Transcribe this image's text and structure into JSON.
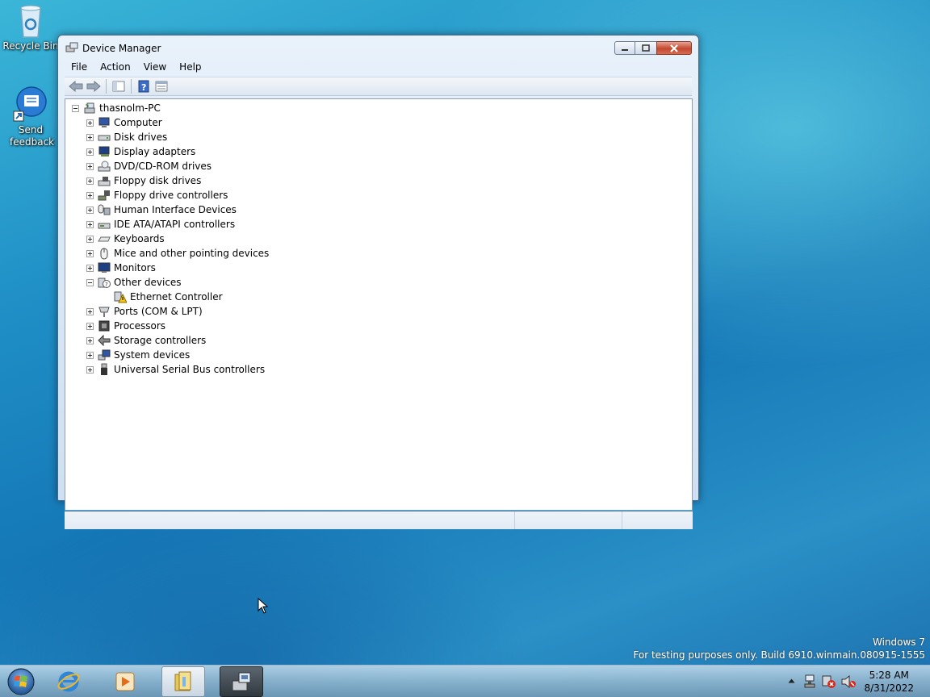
{
  "desktop": {
    "icons": [
      {
        "label": "Recycle Bin"
      },
      {
        "label": "Send feedback"
      }
    ],
    "watermark": {
      "line1": "Windows 7",
      "line2": "For testing purposes only. Build 6910.winmain.080915-1555"
    }
  },
  "window": {
    "title": "Device Manager",
    "menu": [
      "File",
      "Action",
      "View",
      "Help"
    ],
    "tree": {
      "root": "thasnolm-PC",
      "categories": [
        {
          "label": "Computer",
          "icon": "computer-icon"
        },
        {
          "label": "Disk drives",
          "icon": "disk-drive-icon"
        },
        {
          "label": "Display adapters",
          "icon": "display-adapter-icon"
        },
        {
          "label": "DVD/CD-ROM drives",
          "icon": "dvd-drive-icon"
        },
        {
          "label": "Floppy disk drives",
          "icon": "floppy-drive-icon"
        },
        {
          "label": "Floppy drive controllers",
          "icon": "floppy-controller-icon"
        },
        {
          "label": "Human Interface Devices",
          "icon": "hid-icon"
        },
        {
          "label": "IDE ATA/ATAPI controllers",
          "icon": "ide-controller-icon"
        },
        {
          "label": "Keyboards",
          "icon": "keyboard-icon"
        },
        {
          "label": "Mice and other pointing devices",
          "icon": "mouse-icon"
        },
        {
          "label": "Monitors",
          "icon": "monitor-icon"
        },
        {
          "label": "Other devices",
          "icon": "unknown-device-icon",
          "expanded": true
        },
        {
          "label": "Ethernet Controller",
          "icon": "warning-device-icon",
          "child": true
        },
        {
          "label": "Ports (COM & LPT)",
          "icon": "port-icon"
        },
        {
          "label": "Processors",
          "icon": "processor-icon"
        },
        {
          "label": "Storage controllers",
          "icon": "storage-controller-icon"
        },
        {
          "label": "System devices",
          "icon": "system-device-icon"
        },
        {
          "label": "Universal Serial Bus controllers",
          "icon": "usb-icon"
        }
      ]
    }
  },
  "taskbar": {
    "clock": {
      "time": "5:28 AM",
      "date": "8/31/2022"
    }
  }
}
